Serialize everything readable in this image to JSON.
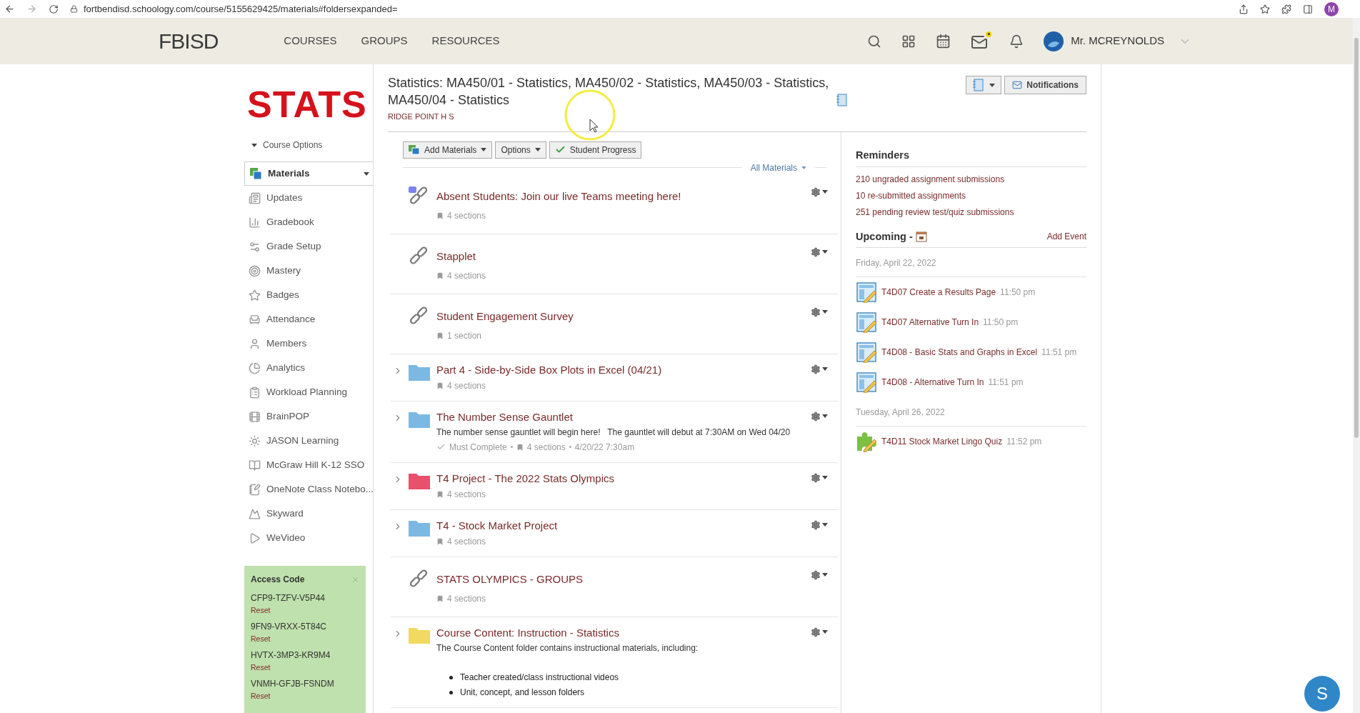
{
  "browser": {
    "url": "fortbendisd.schoology.com/course/5155629425/materials#foldersexpanded=",
    "profile_initial": "M"
  },
  "nav": {
    "logo": "FBISD",
    "links": [
      "COURSES",
      "GROUPS",
      "RESOURCES"
    ],
    "user": "Mr. MCREYNOLDS"
  },
  "sidebar": {
    "course_logo": "STATS",
    "course_options": "Course Options",
    "items": [
      {
        "label": "Materials",
        "selected": true
      },
      {
        "label": "Updates",
        "selected": false
      },
      {
        "label": "Gradebook",
        "selected": false
      },
      {
        "label": "Grade Setup",
        "selected": false
      },
      {
        "label": "Mastery",
        "selected": false
      },
      {
        "label": "Badges",
        "selected": false
      },
      {
        "label": "Attendance",
        "selected": false
      },
      {
        "label": "Members",
        "selected": false
      },
      {
        "label": "Analytics",
        "selected": false
      },
      {
        "label": "Workload Planning",
        "selected": false
      },
      {
        "label": "BrainPOP",
        "selected": false
      },
      {
        "label": "JASON Learning",
        "selected": false
      },
      {
        "label": "McGraw Hill K-12 SSO",
        "selected": false
      },
      {
        "label": "OneNote Class Notebo...",
        "selected": false
      },
      {
        "label": "Skyward",
        "selected": false
      },
      {
        "label": "WeVideo",
        "selected": false
      }
    ],
    "access_code": {
      "title": "Access Code",
      "codes": [
        {
          "code": "CFP9-TZFV-V5P44",
          "reset": "Reset"
        },
        {
          "code": "9FN9-VRXX-5T84C",
          "reset": "Reset"
        },
        {
          "code": "HVTX-3MP3-KR9M4",
          "reset": "Reset"
        },
        {
          "code": "VNMH-GFJB-FSNDM",
          "reset": "Reset"
        }
      ]
    }
  },
  "header": {
    "title": "Statistics: MA450/01 - Statistics, MA450/02 - Statistics, MA450/03 - Statistics, MA450/04 - Statistics",
    "school": "RIDGE POINT H S",
    "notifications": "Notifications"
  },
  "toolbar": {
    "buttons": [
      {
        "label": "Add Materials",
        "kind": "add"
      },
      {
        "label": "Options",
        "kind": "options"
      },
      {
        "label": "Student Progress",
        "kind": "progress"
      }
    ],
    "filter": "All Materials"
  },
  "materials": [
    {
      "kind": "teams-link",
      "title": "Absent Students: Join our live Teams meeting here!",
      "sections": "4 sections"
    },
    {
      "kind": "link",
      "title": "Stapplet",
      "sections": "4 sections"
    },
    {
      "kind": "link",
      "title": "Student Engagement Survey",
      "sections": "1 section"
    },
    {
      "kind": "folder",
      "color": "#7bb9e3",
      "expanded": false,
      "title": "Part 4 - Side-by-Side Box Plots in Excel (04/21)",
      "sections": "4 sections"
    },
    {
      "kind": "folder",
      "color": "#7bb9e3",
      "expanded": false,
      "title": "The Number Sense Gauntlet",
      "description": "The number sense gauntlet will begin here!   The gauntlet will debut at 7:30AM on Wed 04/20",
      "must_complete": "Must Complete",
      "sections": "4 sections",
      "date": "4/20/22 7:30am"
    },
    {
      "kind": "folder",
      "color": "#e9506c",
      "expanded": false,
      "title": "T4 Project - The 2022 Stats Olympics",
      "sections": "4 sections"
    },
    {
      "kind": "folder",
      "color": "#7bb9e3",
      "expanded": false,
      "title": "T4 - Stock Market Project",
      "sections": "4 sections"
    },
    {
      "kind": "link",
      "title": "STATS OLYMPICS - GROUPS",
      "sections": "4 sections"
    },
    {
      "kind": "folder",
      "color": "#f2d961",
      "expanded": false,
      "title": "Course Content: Instruction - Statistics",
      "description": "The Course Content folder contains instructional materials, including:",
      "bullets": [
        "Teacher created/class instructional videos",
        "Unit, concept, and lesson folders"
      ]
    }
  ],
  "reminders": {
    "title": "Reminders",
    "items": [
      "210 ungraded assignment submissions",
      "10 re-submitted assignments",
      "251 pending review test/quiz submissions"
    ]
  },
  "upcoming": {
    "title": "Upcoming -",
    "add_event": "Add Event",
    "days": [
      {
        "date": "Friday, April 22, 2022",
        "events": [
          {
            "kind": "assignment",
            "title": "T4D07 Create a Results Page",
            "time": "11:50 pm"
          },
          {
            "kind": "assignment",
            "title": "T4D07 Alternative Turn In",
            "time": "11:50 pm"
          },
          {
            "kind": "assignment",
            "title": "T4D08 - Basic Stats and Graphs in Excel",
            "time": "11:51 pm"
          },
          {
            "kind": "assignment",
            "title": "T4D08 - Alternative Turn In",
            "time": "11:51 pm"
          }
        ]
      },
      {
        "date": "Tuesday, April 26, 2022",
        "events": [
          {
            "kind": "quiz",
            "title": "T4D11 Stock Market Lingo Quiz",
            "time": "11:52 pm"
          }
        ]
      }
    ]
  },
  "chat": {
    "initial": "S"
  }
}
